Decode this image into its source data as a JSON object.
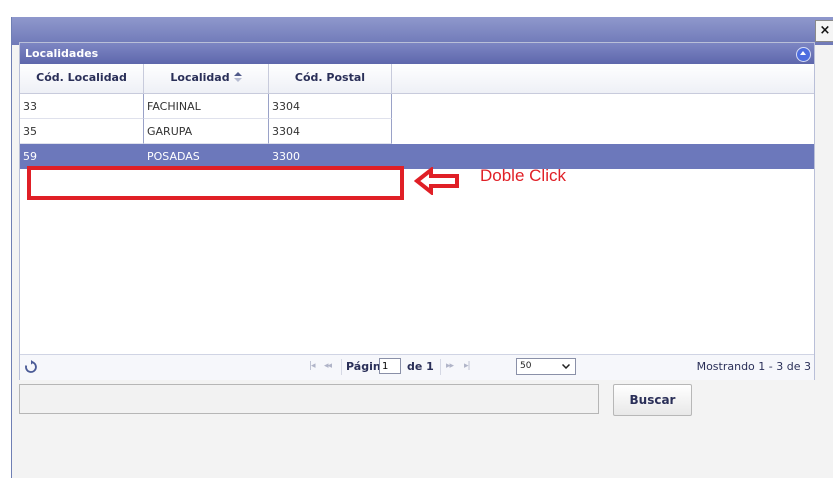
{
  "dialog": {
    "close_label": "×"
  },
  "grid": {
    "caption": "Localidades",
    "columns": [
      {
        "label": "Cód. Localidad"
      },
      {
        "label": "Localidad"
      },
      {
        "label": "Cód. Postal"
      }
    ],
    "rows": [
      {
        "codigo": "33",
        "localidad": "FACHINAL",
        "postal": "3304",
        "selected": false
      },
      {
        "codigo": "35",
        "localidad": "GARUPA",
        "postal": "3304",
        "selected": false
      },
      {
        "codigo": "59",
        "localidad": "POSADAS",
        "postal": "3300",
        "selected": true
      }
    ]
  },
  "annotation": {
    "text": "Doble Click",
    "color": "#e01f26"
  },
  "pager": {
    "page_label": "Página",
    "page_value": "1",
    "of_label": "de 1",
    "page_size": "50",
    "records": "Mostrando 1 - 3 de 3"
  },
  "search": {
    "value": "",
    "button_label": "Buscar"
  },
  "colors": {
    "header": "#6f79b8",
    "selected_row": "#6c78bb",
    "accent": "#e01f26"
  }
}
